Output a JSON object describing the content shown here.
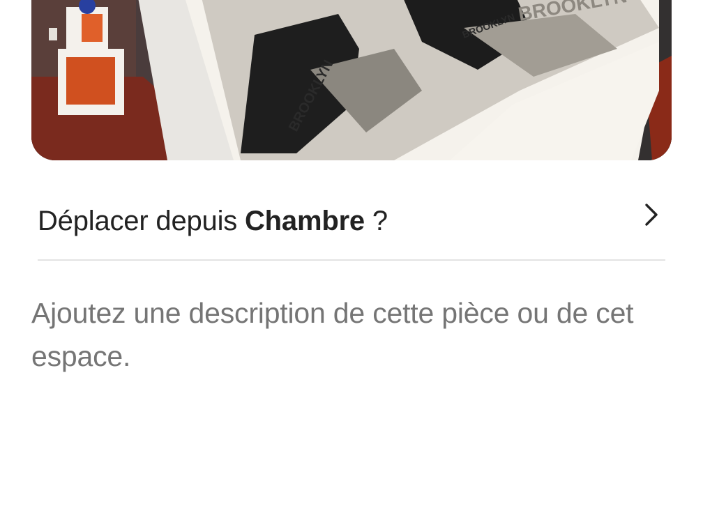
{
  "room_photo": {
    "alt": "Chambre",
    "print_texts": [
      "BROOKLYN",
      "BROOKLYN",
      "BROOKLYN"
    ]
  },
  "move_row": {
    "prefix": "Déplacer depuis",
    "room": "Chambre",
    "suffix": "?",
    "icon": "chevron-right-icon"
  },
  "description": {
    "placeholder": "Ajoutez une description de cette pièce ou de cet espace."
  },
  "colors": {
    "text_primary": "#222222",
    "text_secondary": "#717171",
    "divider": "#e3e3e3"
  }
}
